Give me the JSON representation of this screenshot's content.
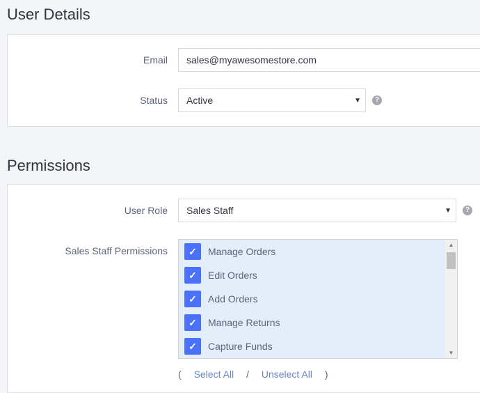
{
  "user_details": {
    "title": "User Details",
    "email_label": "Email",
    "email_value": "sales@myawesomestore.com",
    "status_label": "Status",
    "status_value": "Active"
  },
  "permissions": {
    "title": "Permissions",
    "role_label": "User Role",
    "role_value": "Sales Staff",
    "perm_label": "Sales Staff Permissions",
    "items": [
      {
        "label": "Manage Orders",
        "checked": true
      },
      {
        "label": "Edit Orders",
        "checked": true
      },
      {
        "label": "Add Orders",
        "checked": true
      },
      {
        "label": "Manage Returns",
        "checked": true
      },
      {
        "label": "Capture Funds",
        "checked": true
      }
    ],
    "open_paren": "(",
    "select_all": "Select All",
    "separator": "/",
    "unselect_all": "Unselect All",
    "close_paren": ")"
  },
  "colors": {
    "checkbox": "#4b71fc",
    "list_bg": "#e2eefa",
    "link": "#6b86c8"
  }
}
